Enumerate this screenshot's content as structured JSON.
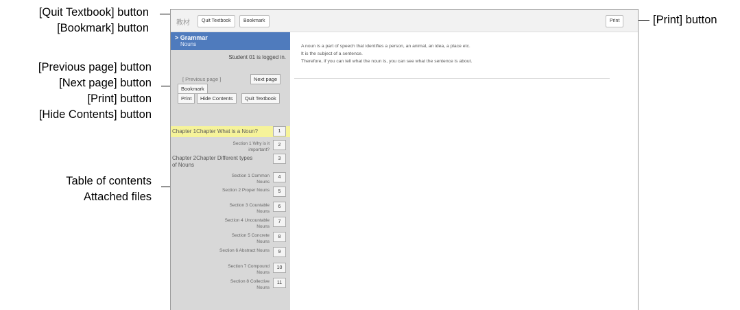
{
  "annotations": {
    "quit_textbook": "[Quit Textbook] button",
    "bookmark": "[Bookmark] button",
    "previous_page": "[Previous page] button",
    "next_page": "[Next page] button",
    "print_left": "[Print] button",
    "hide_contents": "[Hide Contents] button",
    "table_of_contents": "Table of contents",
    "attached_files": "Attached files",
    "print_right": "[Print] button"
  },
  "topbar": {
    "logo_text": "教材",
    "quit_label": "Quit Textbook",
    "bookmark_label": "Bookmark",
    "print_label": "Print"
  },
  "sidebar": {
    "title": "> Grammar",
    "subtitle": "Nouns",
    "logged_in": "Student 01 is logged in.",
    "previous_label": "[ Previous page ]",
    "next_label": "Next page",
    "bookmark_label": "Bookmark",
    "print_label": "Print",
    "hide_contents_label": "Hide Contents",
    "quit_label": "Quit Textbook",
    "toc": [
      {
        "label": "Chapter 1Chapter What is a Noun?",
        "num": "1"
      },
      {
        "label": "Section 1 Why is it important?",
        "num": "2"
      },
      {
        "label": "Chapter 2Chapter Different types of Nouns",
        "num": "3"
      },
      {
        "label": "Section 1 Common Nouns",
        "num": "4"
      },
      {
        "label": "Section 2 Proper Nouns",
        "num": "5"
      },
      {
        "label": "Section 3 Countable Nouns",
        "num": "6"
      },
      {
        "label": "Section 4 Uncountable Nouns",
        "num": "7"
      },
      {
        "label": "Section 5 Concrete Nouns",
        "num": "8"
      },
      {
        "label": "Section 6 Abstract Nouns",
        "num": "9"
      },
      {
        "label": "Section 7 Compound Nouns",
        "num": "10"
      },
      {
        "label": "Section 8 Collective Nouns",
        "num": "11"
      }
    ]
  },
  "content": {
    "lines": [
      "A noun is a part of speech that identifies a person, an animal, an idea, a place etc.",
      "It is the subject of a sentence.",
      "Therefore, if you can tell what the noun is, you can see what the sentence is about."
    ]
  },
  "colors": {
    "header_blue": "#4f7bbd",
    "highlight": "#f6f39a",
    "sidebar_bg": "#d8d8d8"
  }
}
